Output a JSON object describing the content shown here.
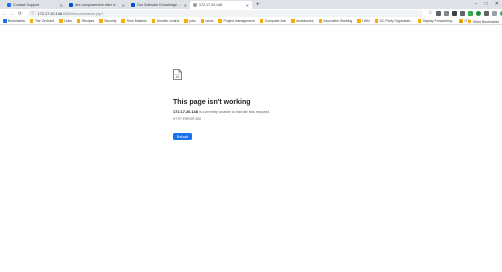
{
  "tabs": [
    {
      "title": "Contact Support",
      "favicon_color": "#1a73e8",
      "active": false
    },
    {
      "title": "Are composersive after database",
      "favicon_color": "#0052cc",
      "active": false
    },
    {
      "title": "Our Software Knowledge base",
      "favicon_color": "#0052cc",
      "active": false
    },
    {
      "title": "172.17.20.148",
      "favicon_color": "#9aa0a6",
      "active": true
    }
  ],
  "new_tab_label": "+",
  "window_controls": {
    "minimize": "−",
    "maximize": "□",
    "close": "✕"
  },
  "toolbar": {
    "back": "←",
    "forward": "→",
    "reload": "⟳",
    "url_host": "172.17.20.148",
    "url_path": ":8080/secure/admin.jsp?"
  },
  "bookmarks": [
    "Bookmarks",
    "The Orchard",
    "Links",
    "Recipes",
    "Security",
    "Time Masters",
    "Smokie control",
    "jobs",
    "news",
    "Project management",
    "Computer Ave",
    "audiobooks",
    "Innovative Working",
    "LWN",
    "DC Party Organisati...",
    "Display Forwarding...",
    "OT"
  ],
  "bookmarks_overflow": "»",
  "other_bookmarks": "Other Bookmarks",
  "error": {
    "icon": "sad-page-icon",
    "title": "This page isn't working",
    "host": "172.17.20.148",
    "message_rest": " is currently unable to handle this request.",
    "code": "HTTP ERROR 500",
    "button": "Reload"
  },
  "colors": {
    "accent": "#1a73e8",
    "tabstrip": "#dee1e6"
  }
}
